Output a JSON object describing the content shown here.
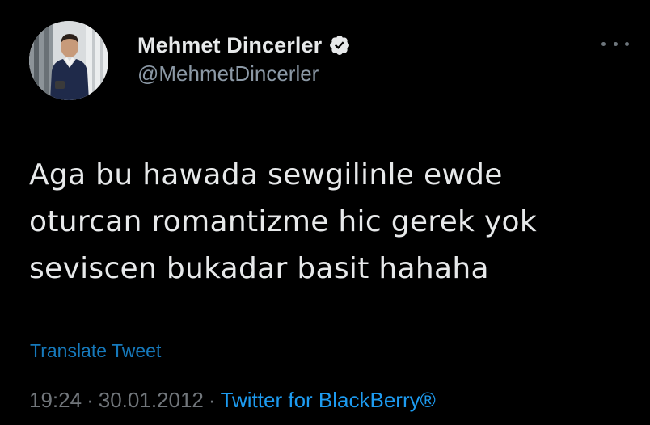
{
  "author": {
    "display_name": "Mehmet Dincerler",
    "handle": "@MehmetDincerler",
    "verified": true,
    "avatar_icon": "profile-photo"
  },
  "tweet": {
    "lines": [
      "Aga bu hawada sewgilinle ewde",
      "oturcan romantizme hic gerek yok",
      "seviscen bukadar basit hahaha"
    ],
    "translate_label": "Translate Tweet"
  },
  "meta": {
    "time": "19:24",
    "date": "30.01.2012",
    "separator": "·",
    "source": "Twitter for BlackBerry®"
  },
  "colors": {
    "background": "#000000",
    "text": "#e7e9ea",
    "muted": "#71767b",
    "link": "#1d9bf0"
  },
  "icons": {
    "verified": "verified-badge-icon",
    "more": "more-options-icon"
  }
}
